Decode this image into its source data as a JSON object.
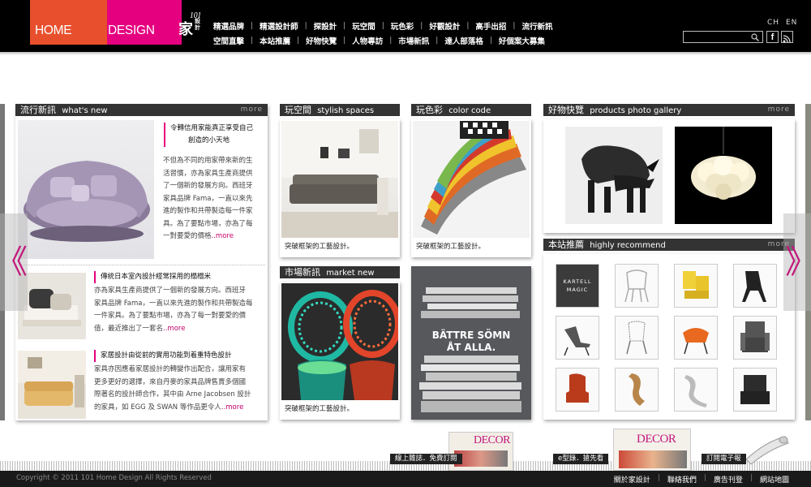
{
  "logo": {
    "home": "HOME",
    "design": "DESIGN",
    "jia": "家",
    "small": "設計",
    "num": "101"
  },
  "nav_row1": [
    "精選品牌",
    "精選設計師",
    "探設計",
    "玩空間",
    "玩色彩",
    "好觀設計",
    "高手出招",
    "流行新訊"
  ],
  "nav_row2": [
    "空間直擊",
    "本站推薦",
    "好物快覽",
    "人物專訪",
    "市場新訊",
    "達人部落格",
    "好個案大募集"
  ],
  "lang": [
    "CH",
    "EN"
  ],
  "search": {
    "placeholder": ""
  },
  "social": {
    "fb": "f"
  },
  "trends": {
    "zh": "流行新訊",
    "en": "what's new",
    "more": "more",
    "articles": [
      {
        "title": "令轉信用家能真正享受自己",
        "title2": "創造的小天地",
        "body": [
          "不但為不同的用家帶來新的生",
          "活習慣，亦為家具生產商提供",
          "了一個新的發展方向。西班牙",
          "家具品牌 Fama，一直以來先",
          "進的製作和共帶製造每一件家",
          "具。為了要點市場，亦為了每",
          "一對要愛的價格"
        ],
        "more": "..more"
      },
      {
        "title": "傳統日本室內設計經常採用的榻榻米",
        "body": [
          "亦為家具生產商提供了一個新的發展方向。西班牙",
          "家具品牌 Fama，一直以來先進的製作和共帶製造每",
          "一件家具。為了要點市場，亦為了每一對要愛的價",
          "值，最近推出了一套名"
        ],
        "more": "..more"
      },
      {
        "title": "家居設計由從前的實用功能到着重特色設計",
        "body": [
          "家具亦因應着家居設計的轉變作出配合，讓用家有",
          "更多更好的選擇，來自丹麥的家具品牌售賣多個國",
          "際著名的設計師合作，其中由 Arne Jacobsen 設計",
          "的家具，如 EGG 及 SWAN 等作品更令人"
        ],
        "more": "..more"
      }
    ]
  },
  "spaces": {
    "zh": "玩空間",
    "en": "stylish spaces",
    "caption": "突破框架的工藝設計。"
  },
  "colors": {
    "zh": "玩色彩",
    "en": "color code",
    "caption": "突破框架的工藝設計。"
  },
  "market": {
    "zh": "市場新訊",
    "en": "market new",
    "caption": "突破框架的工藝設計。"
  },
  "ikea": {
    "line1": "BÄTTRE SÖMN",
    "line2": "ÅT ALLA."
  },
  "products": {
    "zh": "好物快覽",
    "en": "products photo gallery",
    "more": "more"
  },
  "recommend": {
    "zh": "本站推薦",
    "en": "highly recommend",
    "more": "more",
    "badge1": "KARTELL",
    "badge2": "MAGIC"
  },
  "arrows": {
    "left": "《",
    "right": "》"
  },
  "promos": {
    "magazine": "線上雜誌．免費訂閱",
    "catalog": "e型錄．搶先看",
    "subscribe": "訂閱電子報",
    "decor": "DECOR"
  },
  "footer": {
    "copyright": "Copyright © 2011  101 Home Design All Rights Reserved",
    "links": [
      "關於家設計",
      "聯絡我們",
      "廣告刊登",
      "網站地圖"
    ]
  },
  "colors_theme": {
    "accent": "#e4007f",
    "orange": "#e8502d",
    "header": "#000000"
  }
}
